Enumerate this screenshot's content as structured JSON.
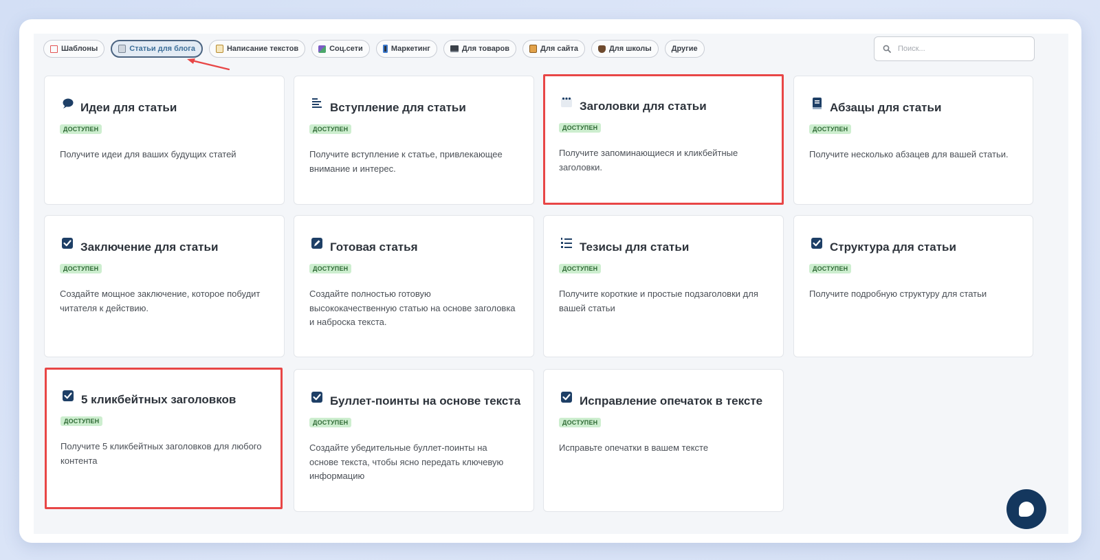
{
  "tabs": [
    {
      "label": "Шаблоны",
      "icon": "template-icon",
      "color": "#e25252",
      "active": false
    },
    {
      "label": "Статьи для блога",
      "icon": "notebook-icon",
      "color": "#8a97a6",
      "active": true
    },
    {
      "label": "Написание текстов",
      "icon": "memo-icon",
      "color": "#d4a84a",
      "active": false
    },
    {
      "label": "Соц.сети",
      "icon": "social-icon",
      "color": "#7c5cc6",
      "active": false
    },
    {
      "label": "Маркетинг",
      "icon": "phone-icon",
      "color": "#3d7bd0",
      "active": false
    },
    {
      "label": "Для товаров",
      "icon": "laptop-icon",
      "color": "#3a4048",
      "active": false
    },
    {
      "label": "Для сайта",
      "icon": "ledger-icon",
      "color": "#e2a24a",
      "active": false
    },
    {
      "label": "Для школы",
      "icon": "mask-icon",
      "color": "#6e4a2e",
      "active": false
    },
    {
      "label": "Другие",
      "icon": "",
      "color": "",
      "active": false
    }
  ],
  "search": {
    "placeholder": "Поиск..."
  },
  "status_label": "доступен",
  "cards": [
    {
      "title": "Идеи для статьи",
      "icon": "speech-bubble-icon",
      "description": "Получите идеи для ваших будущих статей",
      "highlighted": false
    },
    {
      "title": "Вступление для статьи",
      "icon": "text-lines-icon",
      "description": "Получите вступление к статье, привлекающее внимание и интерес.",
      "highlighted": false
    },
    {
      "title": "Заголовки для статьи",
      "icon": "dots-window-icon",
      "description": "Получите запоминающиеся и кликбейтные заголовки.",
      "highlighted": true
    },
    {
      "title": "Абзацы для статьи",
      "icon": "book-icon",
      "description": "Получите несколько абзацев для вашей статьи.",
      "highlighted": false
    },
    {
      "title": "Заключение для статьи",
      "icon": "checkbox-icon",
      "description": "Создайте мощное заключение, которое побудит читателя к действию.",
      "highlighted": false
    },
    {
      "title": "Готовая статья",
      "icon": "pencil-icon",
      "description": "Создайте полностью готовую высококачественную статью на основе заголовка и наброска текста.",
      "highlighted": false
    },
    {
      "title": "Тезисы для статьи",
      "icon": "numbered-list-icon",
      "description": "Получите короткие и простые подзаголовки для вашей статьи",
      "highlighted": false
    },
    {
      "title": "Структура для статьи",
      "icon": "checkbox-icon",
      "description": "Получите подробную структуру для статьи",
      "highlighted": false
    },
    {
      "title": "5 кликбейтных заголовков",
      "icon": "checkbox-icon",
      "description": "Получите 5 кликбейтных заголовков для любого контента",
      "highlighted": true
    },
    {
      "title": "Буллет-поинты на основе текста",
      "icon": "checkbox-icon",
      "description": "Создайте убедительные буллет-поинты на основе текста, чтобы ясно передать ключевую информацию",
      "highlighted": false
    },
    {
      "title": "Исправление опечаток в тексте",
      "icon": "checkbox-icon",
      "description": "Исправьте опечатки в вашем тексте",
      "highlighted": false
    }
  ],
  "colors": {
    "accent": "#e84646",
    "icon": "#1e3f66",
    "badge_bg": "#cdeecf",
    "badge_text": "#2f6a35",
    "chat": "#14375e"
  }
}
